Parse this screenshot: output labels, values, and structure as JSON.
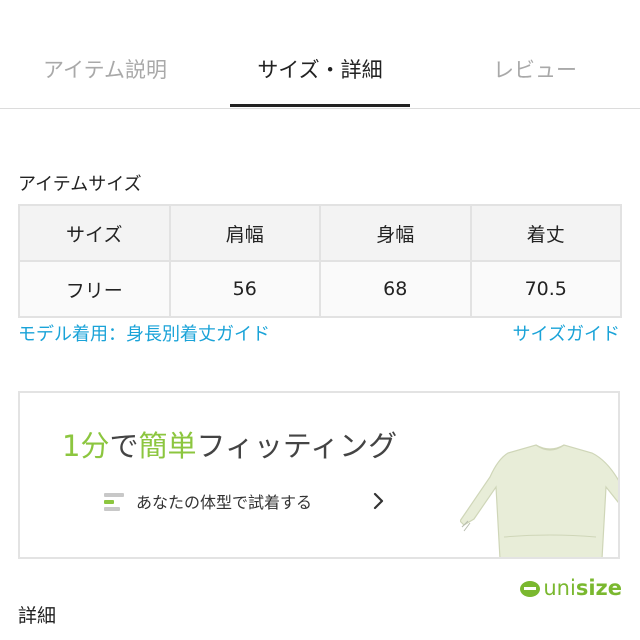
{
  "tabs": [
    {
      "label": "アイテム説明",
      "active": false
    },
    {
      "label": "サイズ・詳細",
      "active": true
    },
    {
      "label": "レビュー",
      "active": false
    }
  ],
  "item_size": {
    "title": "アイテムサイズ",
    "headers": [
      "サイズ",
      "肩幅",
      "身幅",
      "着丈"
    ],
    "rows": [
      [
        "フリー",
        "56",
        "68",
        "70.5"
      ]
    ]
  },
  "links": {
    "model_guide": "モデル着用：身長別着丈ガイド",
    "size_guide": "サイズガイド"
  },
  "fitting": {
    "title_parts": {
      "num": "1分",
      "de": "で",
      "kantan": "簡単",
      "rest": "フィッティング"
    },
    "subtitle": "あなたの体型で試着する"
  },
  "brand": {
    "uni": "uni",
    "size": "size"
  },
  "details": {
    "title": "詳細"
  },
  "colors": {
    "accent_green": "#8cc63f",
    "link_blue": "#1aa3d8",
    "inactive_tab": "#a9a9a9"
  },
  "icons": [
    "size-bars-icon",
    "chevron-right-icon",
    "sweater-illustration",
    "unisize-logo-icon"
  ]
}
